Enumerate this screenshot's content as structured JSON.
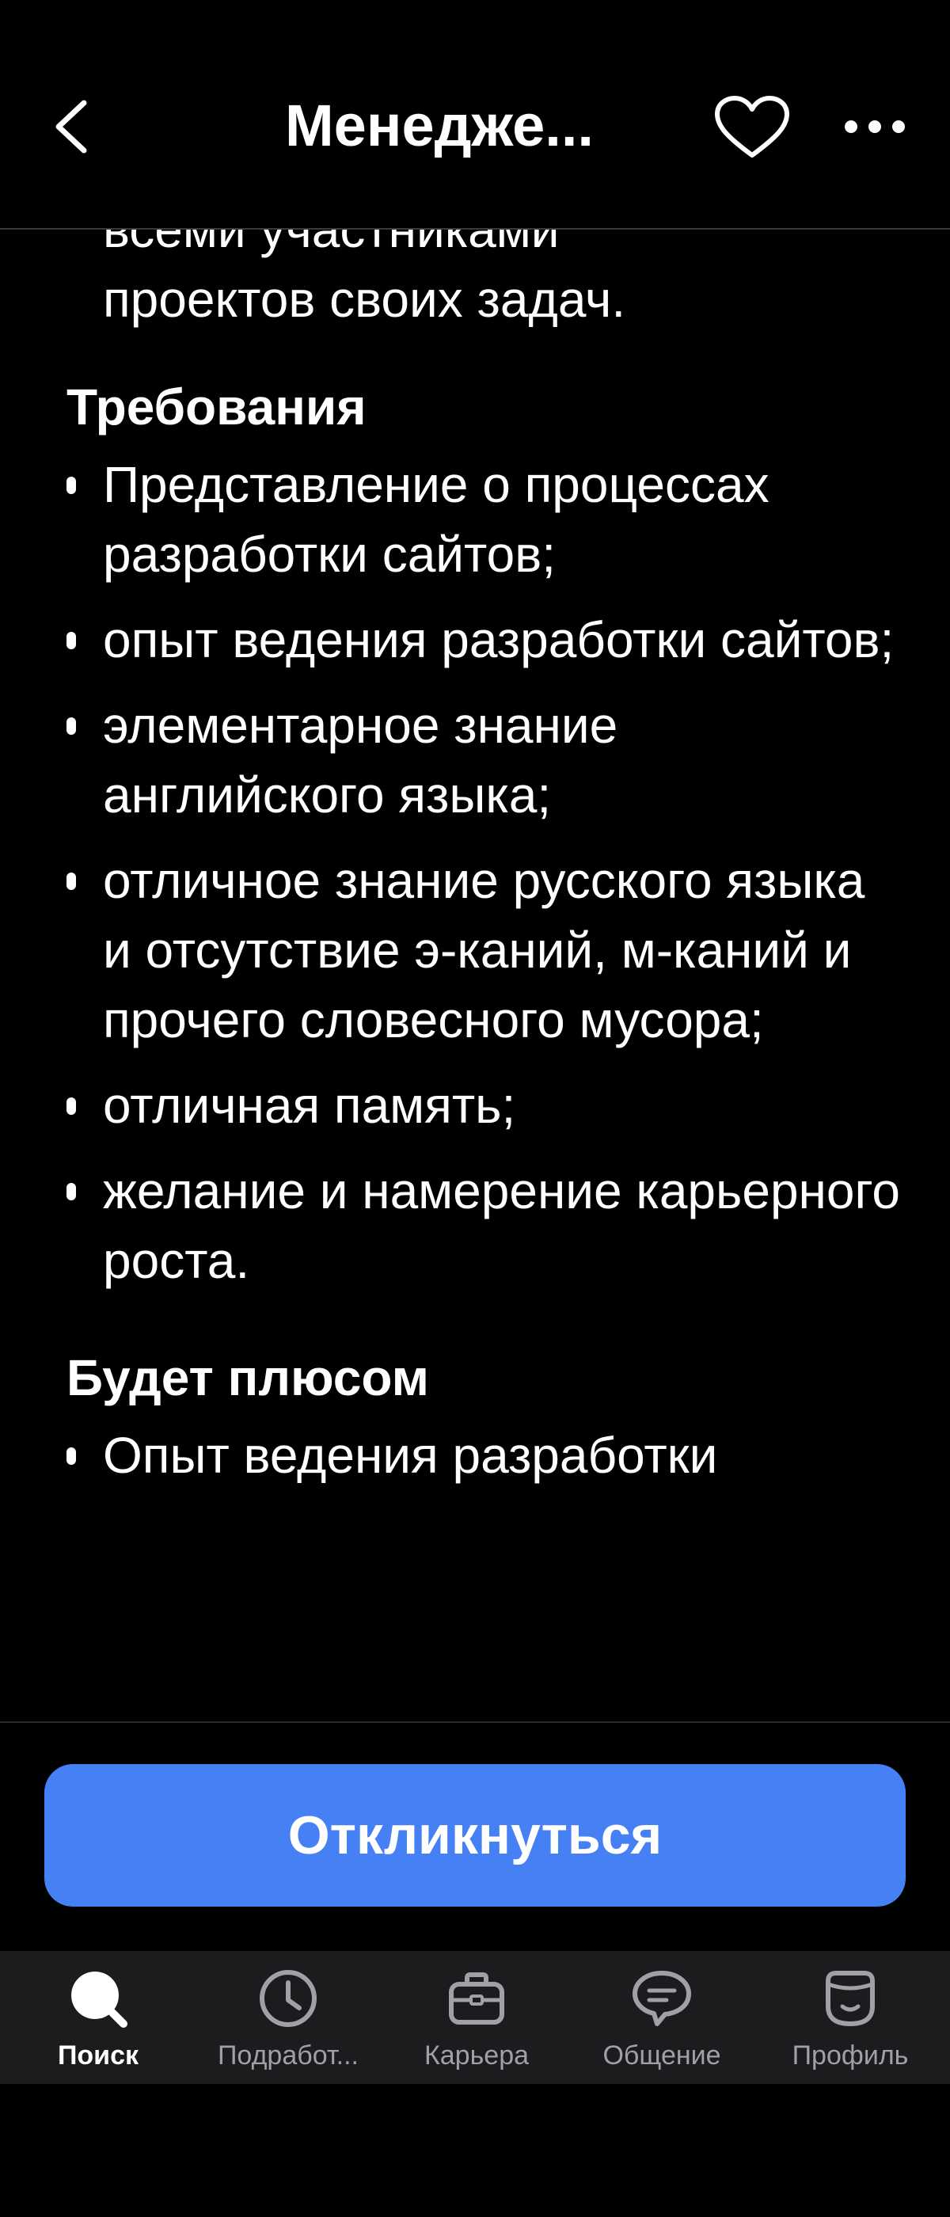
{
  "header": {
    "title": "Менедже...",
    "back_icon": "chevron-left-icon",
    "favorite_icon": "heart-icon",
    "more_icon": "more-dots-icon"
  },
  "content": {
    "continued_lines": [
      "всеми участниками",
      "проектов своих задач."
    ],
    "requirements": {
      "title": "Требования",
      "items": [
        "Представление о процессах разработки сайтов;",
        "опыт ведения разработки сайтов;",
        "элементарное знание английского языка;",
        "отличное знание русского языка и отсутствие э-каний, м-каний и прочего словесного мусора;",
        "отличная память;",
        "желание и намерение карьерного роста."
      ]
    },
    "plus": {
      "title": "Будет плюсом",
      "items": [
        "Опыт ведения разработки"
      ]
    }
  },
  "action": {
    "apply_label": "Откликнуться",
    "button_color": "#4680f5"
  },
  "tabbar": {
    "active_index": 0,
    "tabs": [
      {
        "label": "Поиск",
        "icon": "search-icon"
      },
      {
        "label": "Подработ...",
        "icon": "clock-icon"
      },
      {
        "label": "Карьера",
        "icon": "briefcase-icon"
      },
      {
        "label": "Общение",
        "icon": "chat-bubble-icon"
      },
      {
        "label": "Профиль",
        "icon": "profile-face-icon"
      }
    ]
  }
}
